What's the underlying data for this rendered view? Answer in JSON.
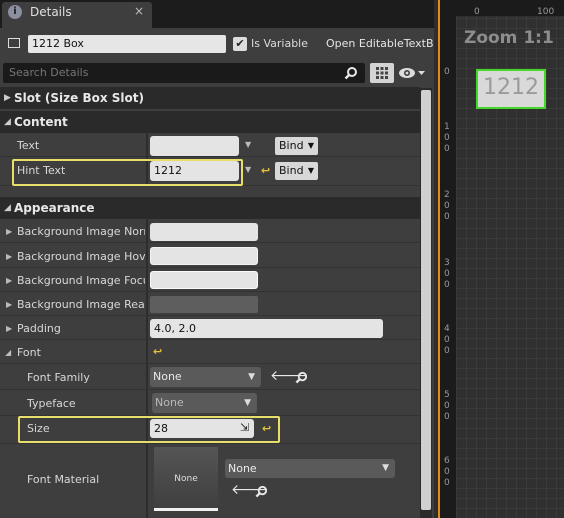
{
  "tab": {
    "title": "Details",
    "close": "×",
    "icon": "details-info-icon"
  },
  "header": {
    "widget_name": "1212 Box",
    "is_variable_checked": true,
    "is_variable_label": "Is Variable",
    "open_link": "Open EditableTextBox"
  },
  "search": {
    "placeholder": "Search Details"
  },
  "categories": {
    "slot": "Slot (Size Box Slot)",
    "content": "Content",
    "appearance": "Appearance"
  },
  "content": {
    "text": {
      "label": "Text",
      "value": "",
      "bind": "Bind"
    },
    "hint_text": {
      "label": "Hint Text",
      "value": "1212",
      "bind": "Bind"
    }
  },
  "appearance": {
    "bg_normal": {
      "label": "Background Image Normal"
    },
    "bg_hover": {
      "label": "Background Image Hovered"
    },
    "bg_focus": {
      "label": "Background Image Focused"
    },
    "bg_readonly": {
      "label": "Background Image Read Only"
    },
    "padding": {
      "label": "Padding",
      "value": "4.0, 2.0"
    },
    "font": {
      "label": "Font"
    },
    "font_family": {
      "label": "Font Family",
      "value": "None"
    },
    "typeface": {
      "label": "Typeface",
      "value": "None"
    },
    "size": {
      "label": "Size",
      "value": "28"
    },
    "font_material": {
      "label": "Font Material",
      "thumb": "None",
      "value": "None"
    }
  },
  "viewport": {
    "zoom": "Zoom 1:1",
    "preview_text": "1212",
    "ruler_top": [
      "0",
      "100"
    ],
    "ruler_left": [
      "0",
      "1 0 0",
      "2 0 0",
      "3 0 0",
      "4 0 0",
      "5 0 0",
      "6 0 0"
    ]
  },
  "colors": {
    "highlight": "#e8df6a",
    "selection": "#44d92a",
    "reset_arrow": "#e6c13a",
    "viewport_border": "#e28a1d"
  }
}
